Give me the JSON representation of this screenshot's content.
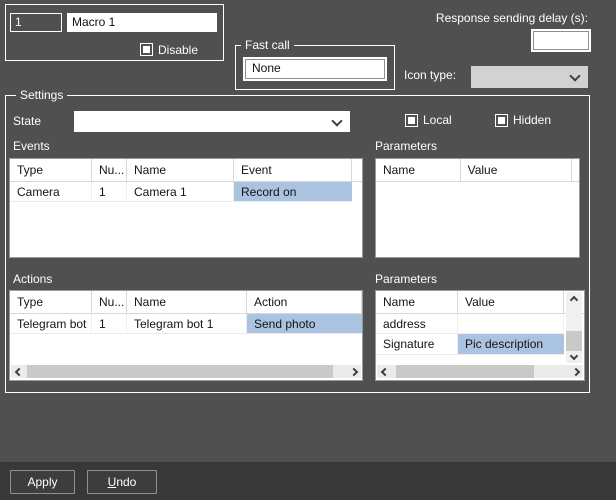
{
  "macro": {
    "number": "1",
    "name": "Macro 1",
    "disable_label": "Disable"
  },
  "fast_call": {
    "title": "Fast call",
    "value": "None"
  },
  "response_delay": {
    "label": "Response sending delay (s):",
    "value": ""
  },
  "icon_type": {
    "label": "Icon type:",
    "value": ""
  },
  "settings": {
    "title": "Settings",
    "state_label": "State",
    "state_value": "",
    "local_label": "Local",
    "hidden_label": "Hidden",
    "events": {
      "label": "Events",
      "columns": [
        "Type",
        "Nu...",
        "Name",
        "Event"
      ],
      "rows": [
        {
          "type": "Camera",
          "number": "1",
          "name": "Camera 1",
          "event": "Record on"
        }
      ]
    },
    "event_parameters": {
      "label": "Parameters",
      "columns": [
        "Name",
        "Value"
      ],
      "rows": []
    },
    "actions": {
      "label": "Actions",
      "columns": [
        "Type",
        "Nu...",
        "Name",
        "Action"
      ],
      "rows": [
        {
          "type": "Telegram bot",
          "number": "1",
          "name": "Telegram bot 1",
          "action": "Send photo"
        }
      ]
    },
    "action_parameters": {
      "label": "Parameters",
      "columns": [
        "Name",
        "Value"
      ],
      "rows": [
        {
          "name": "address",
          "value": ""
        },
        {
          "name": "Signature",
          "value": "Pic description"
        }
      ]
    }
  },
  "footer": {
    "apply_label": "Apply",
    "undo_first_letter": "U",
    "undo_rest": "ndo"
  },
  "colors": {
    "background": "#505050",
    "footer_background": "#383838",
    "selection": "#a9c3e0",
    "group_border": "#ffffff"
  }
}
